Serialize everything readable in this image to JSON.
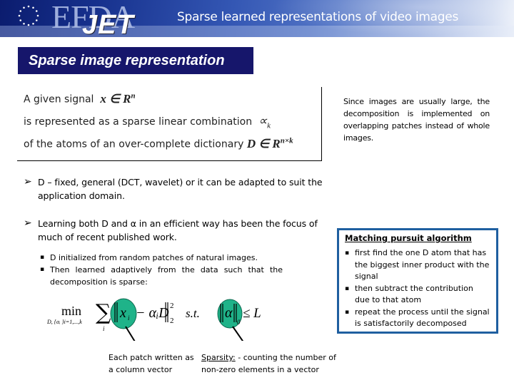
{
  "header": {
    "logo_primary": "EFDA",
    "logo_secondary": "JET",
    "title": "Sparse learned representations of video images",
    "flag_icon": "eu-flag-icon"
  },
  "section_title": "Sparse image representation",
  "definition": {
    "line1_text": "A given signal",
    "line1_math": "x ∈ R",
    "line1_sup": "n",
    "line2_text": "is represented as a sparse linear combination",
    "line2_math": "∝",
    "line2_sub": "k",
    "line3_text": "of the atoms of an over-complete dictionary",
    "line3_math": "D ∈ R",
    "line3_sup": "n×k"
  },
  "side_note": "Since images are usually large, the decomposition is implemented on overlapping patches instead of whole images.",
  "bullets": [
    {
      "icon": "arrow-bullet-icon",
      "glyph": "➢",
      "text": "D – fixed, general (DCT, wavelet) or it can be adapted to suit the application domain."
    },
    {
      "icon": "arrow-bullet-icon",
      "glyph": "➢",
      "text": "Learning both D and α in an efficient way has been the focus of much of recent published work."
    }
  ],
  "sub_bullets": [
    "D initialized from random patches of natural images.",
    "Then learned adaptively from the data such that the decomposition is sparse:"
  ],
  "formula": {
    "min": "min",
    "min_sub": "D, {αᵢ }i=1,...,k",
    "sum": "∑",
    "sum_sub": "i",
    "term_x": "x",
    "term_x_sub": "i",
    "term_rest": "− αᵢD",
    "norm_sup": "2",
    "norm_sub": "2",
    "st": "s.t.",
    "alpha": "α",
    "alpha_sub": "0",
    "constraint": "≤ L",
    "highlight_color": "#1fb389"
  },
  "captions": {
    "left": "Each patch written as a column vector",
    "right_label": "Sparsity:",
    "right_text": " - counting the number of non-zero elements in a vector"
  },
  "matching_pursuit": {
    "title": "Matching pursuit algorithm",
    "items": [
      "first find the one D atom that has the biggest inner product with the signal",
      " then subtract the contribution due to that atom",
      "repeat the process until the signal is satisfactorily decomposed"
    ],
    "border_color": "#1f5fa0"
  },
  "colors": {
    "section_title_bg": "#16166b",
    "banner_dark": "#0b1c6e"
  }
}
